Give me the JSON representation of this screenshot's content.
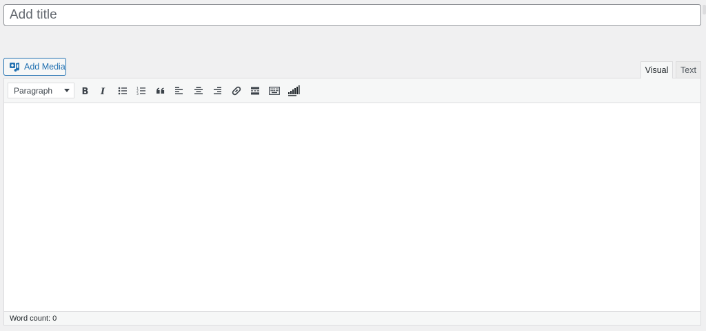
{
  "title": {
    "placeholder": "Add title"
  },
  "media": {
    "button_label": "Add Media"
  },
  "tabs": {
    "visual": "Visual",
    "text": "Text"
  },
  "toolbar": {
    "format_value": "Paragraph",
    "buttons": [
      "bold-icon",
      "italic-icon",
      "bulleted-list-icon",
      "numbered-list-icon",
      "blockquote-icon",
      "align-left-icon",
      "align-center-icon",
      "align-right-icon",
      "link-icon",
      "read-more-icon",
      "toolbar-toggle-icon",
      "signal-bars-icon"
    ]
  },
  "status": {
    "word_count": "Word count: 0"
  },
  "colors": {
    "accent": "#2271b1",
    "background": "#f0f0f1",
    "border": "#dcdcde"
  }
}
